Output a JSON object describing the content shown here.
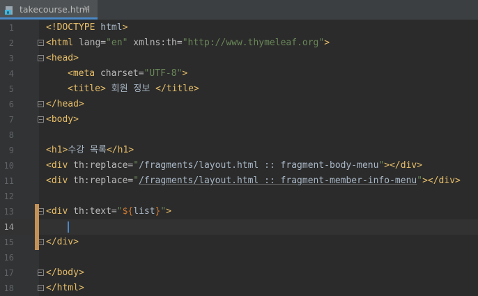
{
  "tab": {
    "file_name": "takecourse.html",
    "close_glyph": "✕",
    "icon": "html-file-icon"
  },
  "colors": {
    "tag": "#e8bf6a",
    "attr": "#bababa",
    "value": "#6a8759",
    "text": "#a9b7c6",
    "accent": "#4a88c7",
    "change_marker": "#c59256"
  },
  "lines": [
    {
      "n": "1"
    },
    {
      "n": "2"
    },
    {
      "n": "3"
    },
    {
      "n": "4"
    },
    {
      "n": "5"
    },
    {
      "n": "6"
    },
    {
      "n": "7"
    },
    {
      "n": "8"
    },
    {
      "n": "9"
    },
    {
      "n": "10"
    },
    {
      "n": "11"
    },
    {
      "n": "12"
    },
    {
      "n": "13"
    },
    {
      "n": "14"
    },
    {
      "n": "15"
    },
    {
      "n": "16"
    },
    {
      "n": "17"
    },
    {
      "n": "18"
    }
  ],
  "code": {
    "l1": {
      "a": "<!DOCTYPE ",
      "b": "html",
      "c": ">"
    },
    "l2": {
      "a": "<html ",
      "b": "lang=",
      "c": "\"en\"",
      "d": " xmlns:th=",
      "e": "\"http://www.thymeleaf.org\"",
      "f": ">"
    },
    "l3": {
      "a": "<head>"
    },
    "l4": {
      "a": "<meta ",
      "b": "charset=",
      "c": "\"UTF-8\"",
      "d": ">"
    },
    "l5": {
      "a": "<title>",
      "b": " 회원 정보 ",
      "c": "</title>"
    },
    "l6": {
      "a": "</head>"
    },
    "l7": {
      "a": "<body>"
    },
    "l9": {
      "a": "<h1>",
      "b": "수강 목록",
      "c": "</h1>"
    },
    "l10": {
      "a": "<div ",
      "b": "th:replace=",
      "c": "\"",
      "d": "/fragments/layout.html :: fragment-body-menu",
      "e": "\"",
      "f": "></div>"
    },
    "l11": {
      "a": "<div ",
      "b": "th:replace=",
      "c": "\"",
      "d": "/fragments/layout.html :: fragment-member-info-menu",
      "e": "\"",
      "f": "></div>"
    },
    "l13": {
      "a": "<div ",
      "b": "th:text=",
      "c": "\"",
      "d": "${",
      "e": "list",
      "f": "}",
      "g": "\"",
      "h": ">"
    },
    "l15": {
      "a": "</div>"
    },
    "l17": {
      "a": "</body>"
    },
    "l18": {
      "a": "</html>"
    }
  }
}
